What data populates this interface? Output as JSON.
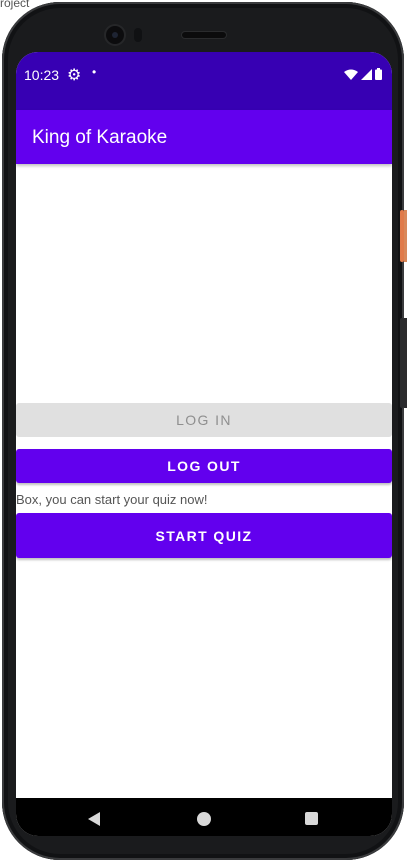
{
  "background": {
    "text": "roject"
  },
  "status_bar": {
    "time": "10:23",
    "settings_icon": "gear-icon",
    "dot": "•"
  },
  "app_bar": {
    "title": "King of Karaoke"
  },
  "buttons": {
    "login": "LOG IN",
    "logout": "LOG OUT",
    "start_quiz": "START QUIZ"
  },
  "message": "Box, you can start your quiz now!",
  "nav_bar": {
    "back": "back-icon",
    "home": "home-icon",
    "recents": "recents-icon"
  },
  "colors": {
    "primary": "#6200ee",
    "primary_dark": "#3700b3",
    "disabled_button": "#e0e0e0"
  }
}
